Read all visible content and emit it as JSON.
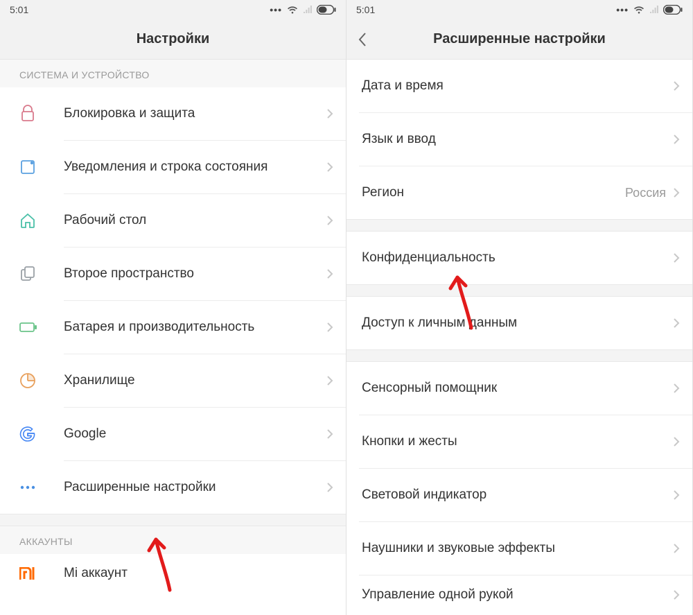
{
  "statusbar": {
    "time": "5:01"
  },
  "left": {
    "title": "Настройки",
    "section1": "СИСТЕМА И УСТРОЙСТВО",
    "items": [
      {
        "label": "Блокировка и защита"
      },
      {
        "label": "Уведомления и строка состояния"
      },
      {
        "label": "Рабочий стол"
      },
      {
        "label": "Второе пространство"
      },
      {
        "label": "Батарея и производительность"
      },
      {
        "label": "Хранилище"
      },
      {
        "label": "Google"
      },
      {
        "label": "Расширенные настройки"
      }
    ],
    "section2": "АККАУНТЫ",
    "account_item": "Mi аккаунт"
  },
  "right": {
    "title": "Расширенные настройки",
    "items": [
      {
        "label": "Дата и время"
      },
      {
        "label": "Язык и ввод"
      },
      {
        "label": "Регион",
        "value": "Россия"
      },
      {
        "label": "Конфиденциальность"
      },
      {
        "label": "Доступ к личным данным"
      },
      {
        "label": "Сенсорный помощник"
      },
      {
        "label": "Кнопки и жесты"
      },
      {
        "label": "Световой индикатор"
      },
      {
        "label": "Наушники и звуковые эффекты"
      },
      {
        "label": "Управление одной рукой"
      }
    ]
  }
}
